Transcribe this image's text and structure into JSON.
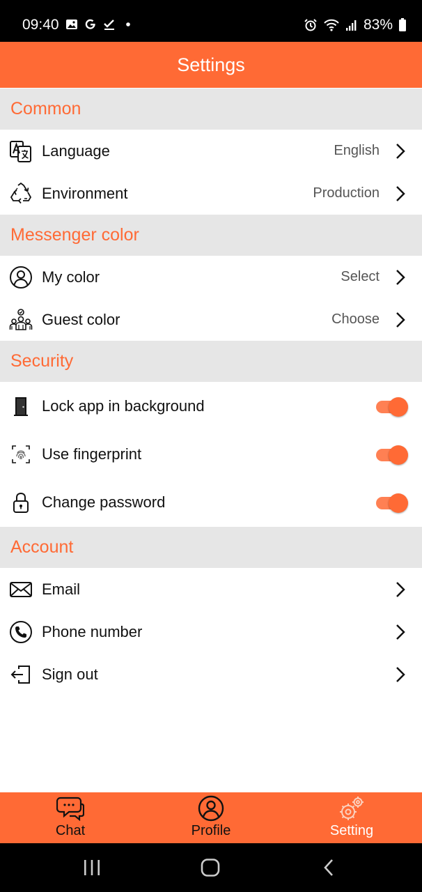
{
  "status_bar": {
    "time": "09:40",
    "battery": "83%",
    "left_icons": [
      "gallery-icon",
      "google-icon",
      "check-icon",
      "dot-icon"
    ],
    "right_icons": [
      "alarm-icon",
      "wifi-icon",
      "signal-icon",
      "battery-icon"
    ]
  },
  "app_bar": {
    "title": "Settings"
  },
  "colors": {
    "accent": "#ff6a35",
    "section_bg": "#e6e6e6"
  },
  "sections": [
    {
      "title": "Common",
      "items": [
        {
          "label": "Language",
          "value": "English",
          "icon": "translate-icon"
        },
        {
          "label": "Environment",
          "value": "Production",
          "icon": "recycle-icon"
        }
      ]
    },
    {
      "title": "Messenger color",
      "items": [
        {
          "label": "My color",
          "value": "Select",
          "icon": "user-circle-icon"
        },
        {
          "label": "Guest color",
          "value": "Choose",
          "icon": "group-icon"
        }
      ]
    },
    {
      "title": "Security",
      "items": [
        {
          "label": "Lock app in background",
          "on": true,
          "icon": "door-icon"
        },
        {
          "label": "Use fingerprint",
          "on": true,
          "icon": "fingerprint-icon"
        },
        {
          "label": "Change password",
          "on": true,
          "icon": "lock-icon"
        }
      ]
    },
    {
      "title": "Account",
      "items": [
        {
          "label": "Email",
          "icon": "envelope-icon"
        },
        {
          "label": "Phone number",
          "icon": "phone-icon"
        },
        {
          "label": "Sign out",
          "icon": "sign-out-icon"
        }
      ]
    }
  ],
  "bottom_nav": {
    "items": [
      {
        "label": "Chat",
        "icon": "chat-bubbles-icon",
        "active": false
      },
      {
        "label": "Profile",
        "icon": "profile-icon",
        "active": false
      },
      {
        "label": "Setting",
        "icon": "gear-icon",
        "active": true
      }
    ]
  },
  "system_nav": [
    "recents-icon",
    "home-icon",
    "back-icon"
  ]
}
